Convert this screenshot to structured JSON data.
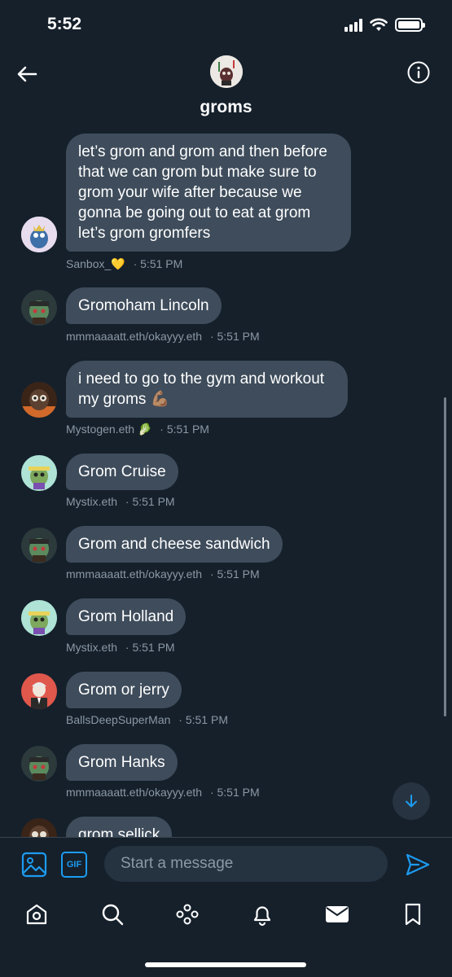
{
  "status_bar": {
    "time": "5:52"
  },
  "header": {
    "title": "groms"
  },
  "messages": [
    {
      "text": "let’s grom and grom and then before that we can grom but make sure to grom your wife after because we gonna be going out to eat at grom let’s grom gromfers",
      "sender": "Sanbox_💛",
      "time": "· 5:51 PM"
    },
    {
      "text": "Gromoham Lincoln",
      "sender": "mmmaaaatt.eth/okayyy.eth",
      "time": "· 5:51 PM"
    },
    {
      "text": "i need to go to the gym and workout my groms 💪🏽",
      "sender": "Mystogen.eth 🥬",
      "time": "· 5:51 PM"
    },
    {
      "text": "Grom Cruise",
      "sender": "Mystix.eth",
      "time": "· 5:51 PM"
    },
    {
      "text": "Grom and cheese sandwich",
      "sender": "mmmaaaatt.eth/okayyy.eth",
      "time": "· 5:51 PM"
    },
    {
      "text": "Grom Holland",
      "sender": "Mystix.eth",
      "time": "· 5:51 PM"
    },
    {
      "text": "Grom or jerry",
      "sender": "BallsDeepSuperMan",
      "time": "· 5:51 PM"
    },
    {
      "text": "Grom Hanks",
      "sender": "mmmaaaatt.eth/okayyy.eth",
      "time": "· 5:51 PM"
    },
    {
      "text": "grom sellick",
      "sender": "",
      "time": ""
    }
  ],
  "composer": {
    "placeholder": "Start a message",
    "gif_label": "GIF"
  },
  "tabbar": {
    "items": [
      "home-icon",
      "search-icon",
      "spaces-icon",
      "notifications-icon",
      "messages-icon",
      "bookmarks-icon"
    ]
  },
  "colors": {
    "background": "#15202b",
    "bubble": "#3e4c5b",
    "accent": "#1d9bf0",
    "meta": "#8b98a5"
  }
}
